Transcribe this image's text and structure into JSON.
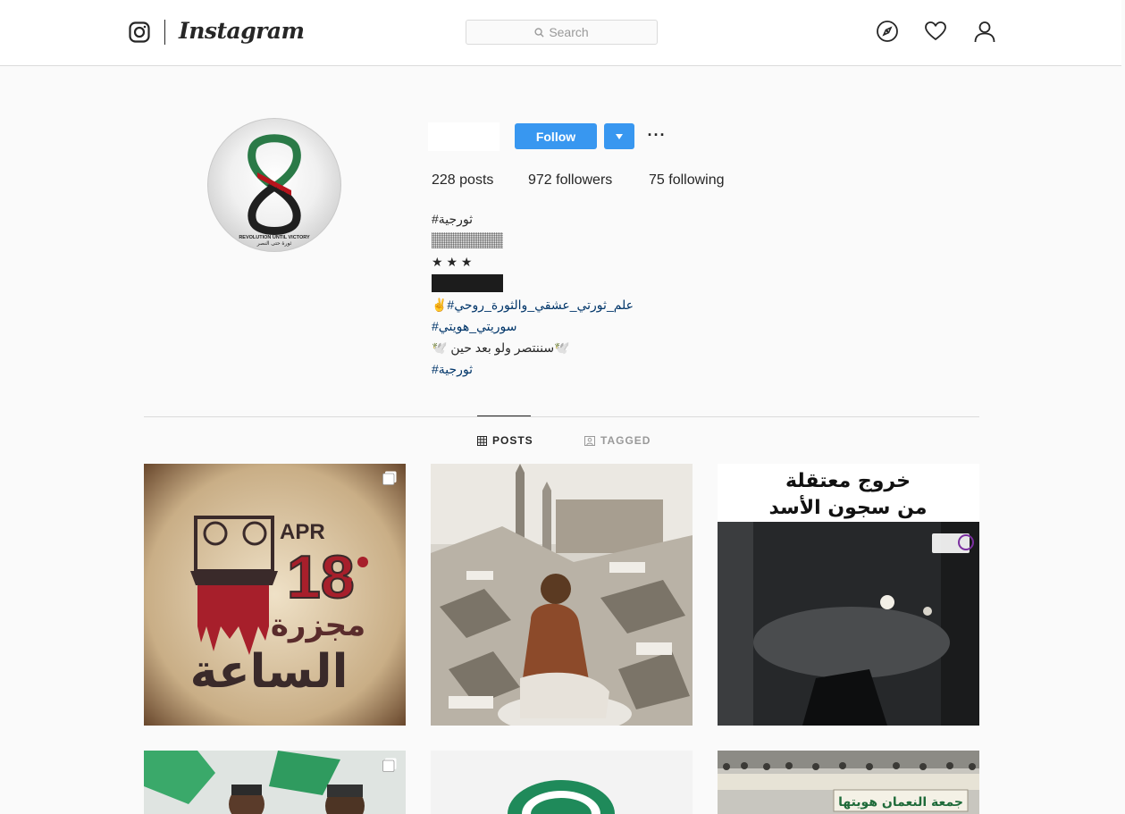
{
  "header": {
    "logo_text": "Instagram",
    "search_placeholder": "Search"
  },
  "profile": {
    "follow_label": "Follow",
    "more_label": "···",
    "stats": {
      "posts": "228 posts",
      "followers": "972 followers",
      "following": "75 following"
    },
    "bio_lines": [
      "#ثورجية",
      "★ ★ ★",
      "✌️#علم_ثورتي_عشقي_والثورة_روحي",
      "#سوريتي_هويتي",
      "🕊️ سننتصر ولو بعد حين🕊️",
      "#ثورجية"
    ],
    "avatar_text_en": "REVOLUTION UNTIL VICTORY",
    "avatar_text_ar": "ثورة حتى النصر"
  },
  "tabs": {
    "posts": "POSTS",
    "tagged": "TAGGED"
  },
  "posts": {
    "post1": {
      "line1": "APR",
      "line2": "18",
      "line3": "مجزرة",
      "line4": "الساعة"
    },
    "post3": {
      "line1": "خروج معتقلة",
      "line2": "من سجون الأسد"
    },
    "post6": {
      "banner": "جمعة النعمان هويتها"
    }
  },
  "colors": {
    "accent": "#3897f0",
    "hashtag": "#003569",
    "border": "#dbdbdb",
    "text": "#262626",
    "muted": "#999999"
  }
}
